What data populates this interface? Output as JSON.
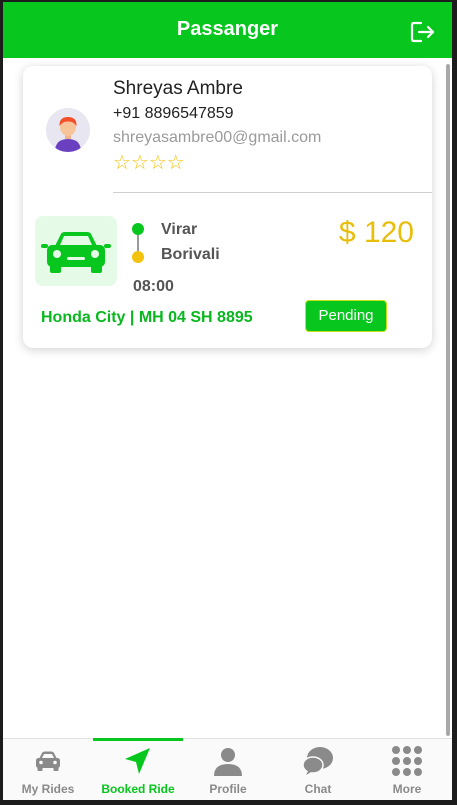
{
  "header": {
    "title": "Passanger",
    "logout_icon": "logout-icon",
    "bg_color": "#07c61d"
  },
  "ride": {
    "passenger_name": "Shreyas Ambre",
    "phone": "+91 8896547859",
    "email": "shreyasambre00@gmail.com",
    "rating_stars": "☆☆☆☆",
    "from": "Virar",
    "to": "Borivali",
    "time": "08:00",
    "price": "$ 120",
    "vehicle": "Honda City | MH 04 SH 8895",
    "status": "Pending"
  },
  "tabs": [
    {
      "label": "My Rides",
      "icon": "car-icon",
      "active": false
    },
    {
      "label": "Booked Ride",
      "icon": "navigation-arrow-icon",
      "active": true
    },
    {
      "label": "Profile",
      "icon": "person-icon",
      "active": false
    },
    {
      "label": "Chat",
      "icon": "chat-bubble-icon",
      "active": false
    },
    {
      "label": "More",
      "icon": "grid-dots-icon",
      "active": false
    }
  ],
  "colors": {
    "accent": "#07c61d",
    "price": "#e8be0b",
    "star": "#f3c20c"
  }
}
